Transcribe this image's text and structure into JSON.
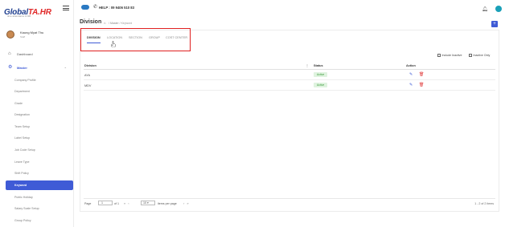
{
  "brand": {
    "logo_main": "Global",
    "logo_hr": "TA.HR",
    "logo_tagline": "time attendance & HR"
  },
  "topbar": {
    "help_text": "HELP : 09 9406 510 83"
  },
  "user": {
    "name": "Kaung Myat Thu",
    "role": "Staff"
  },
  "sidebar": {
    "dashboard": "Dashboard",
    "master": "Master",
    "sub_items": [
      "Company Profile",
      "Department",
      "Grade",
      "Designation",
      "Team Setup",
      "Label Setup",
      "Job Code Setup",
      "Leave Type",
      "Shift Policy",
      "Keyword",
      "Public Holiday",
      "Salary Scale Setup",
      "Group Policy"
    ],
    "active_index": 9
  },
  "page": {
    "title": "Division",
    "breadcrumb_parent": "Master",
    "breadcrumb_current": "Keyword",
    "add_label": "+"
  },
  "tabs": [
    "DIVISION",
    "LOCATION",
    "SECTION",
    "GROUP",
    "COST CENTER"
  ],
  "active_tab": 0,
  "filters": {
    "include_inactive": "Include Inactive",
    "inactive_only": "Inactive Only"
  },
  "table": {
    "columns": [
      "Division",
      "Status",
      "Action"
    ],
    "rows": [
      {
        "division": "AYA",
        "status": "Active"
      },
      {
        "division": "MDV",
        "status": "Active"
      }
    ]
  },
  "pager": {
    "page_label": "Page",
    "page_value": "1",
    "of_label": "of 1",
    "per_page_value": "10",
    "per_page_label": "items per page",
    "range": "1 - 2 of 2 items"
  },
  "colors": {
    "accent": "#3f5bd6",
    "highlight": "#e02020",
    "active_badge_bg": "#dff3df",
    "active_badge_text": "#3a9a3a"
  }
}
